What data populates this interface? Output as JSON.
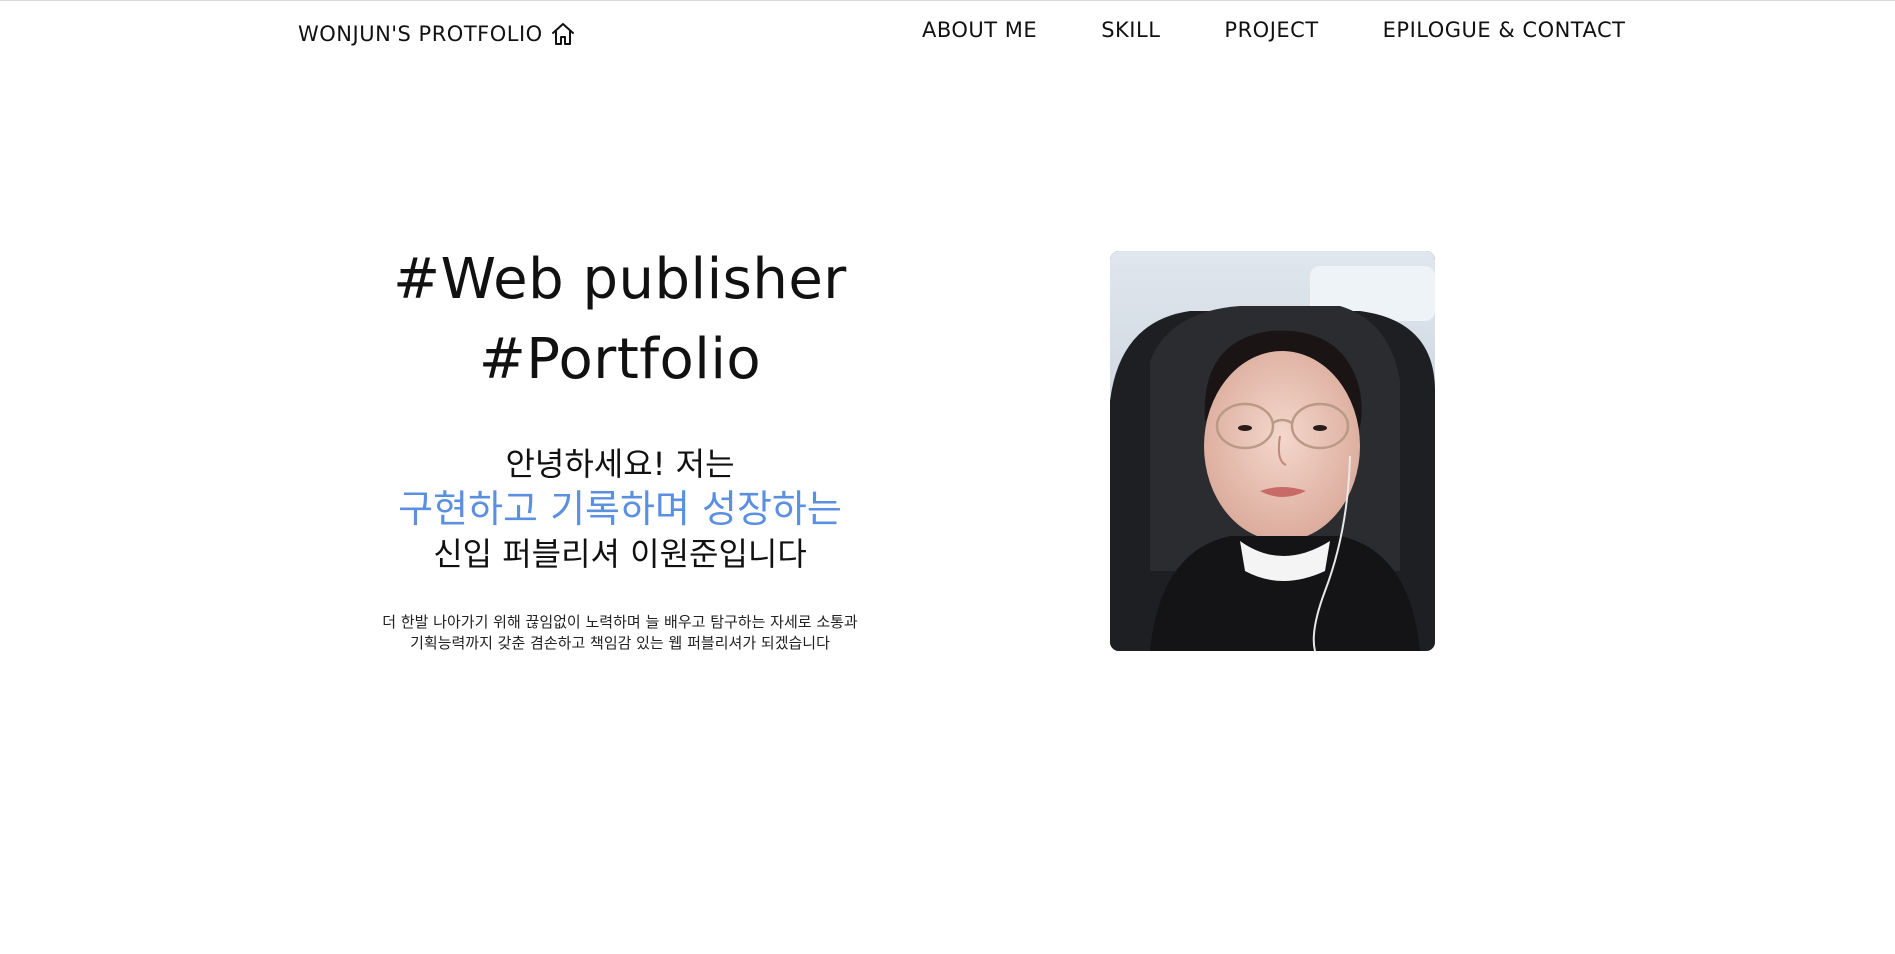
{
  "header": {
    "logo_text": "WONJUN'S PROTFOLIO",
    "logo_icon": "home-icon",
    "nav": [
      {
        "label": "ABOUT ME"
      },
      {
        "label": "SKILL"
      },
      {
        "label": "PROJECT"
      },
      {
        "label": "EPILOGUE & CONTACT"
      }
    ]
  },
  "hero": {
    "headline_line1": "#Web publisher",
    "headline_line2": "#Portfolio",
    "greeting": "안녕하세요! 저는",
    "accent_line": "구현하고 기록하며 성장하는",
    "name_line": "신입 퍼블리셔 이원준입니다",
    "desc_line1": "더 한발 나아가기 위해 끊임없이 노력하며 늘 배우고 탐구하는 자세로 소통과",
    "desc_line2": "기획능력까지 갖춘 겸손하고 책임감 있는 웹 퍼블리셔가 되겠습니다"
  },
  "colors": {
    "accent": "#5b8fe0",
    "text": "#111111",
    "background": "#ffffff"
  }
}
